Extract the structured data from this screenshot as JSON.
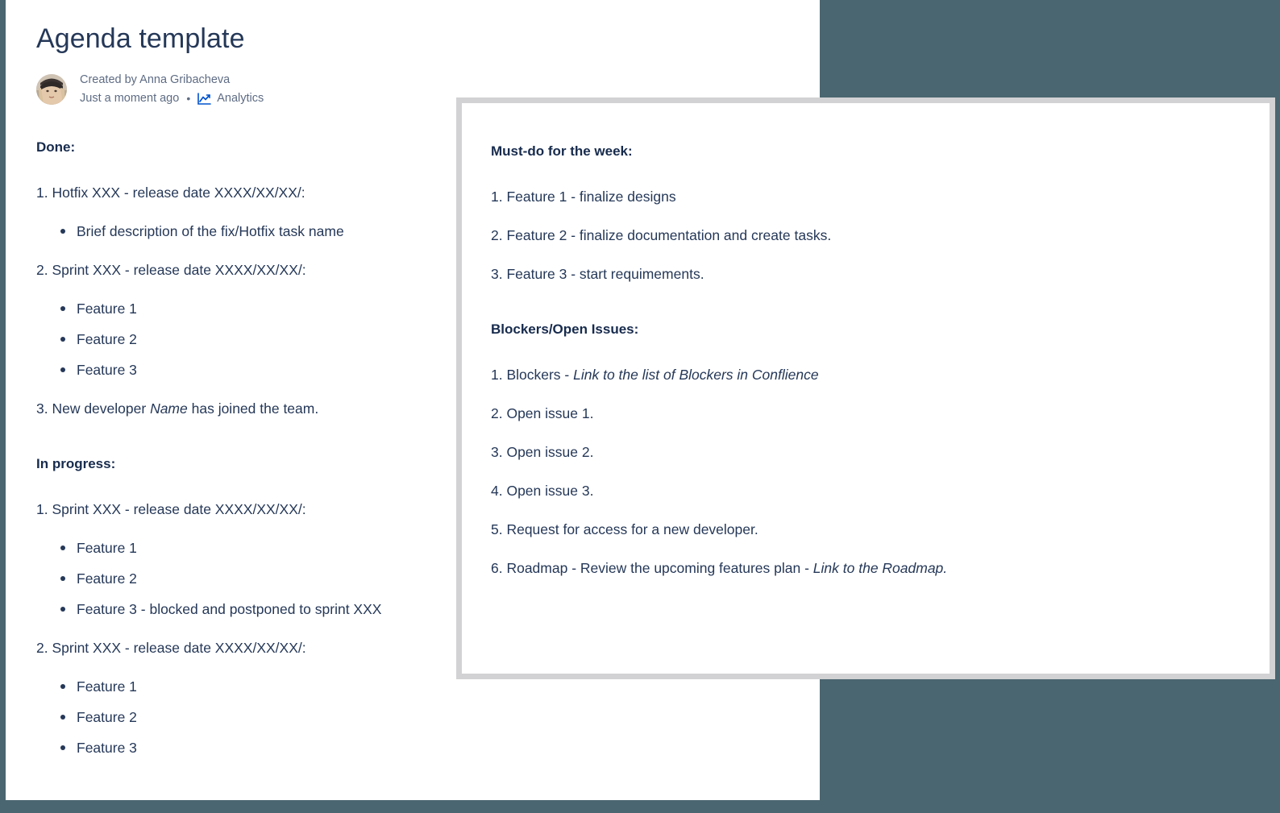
{
  "window": {
    "background_color": "#4a6670",
    "card_background": "#ffffff",
    "card_border_color": "#d2d2d4",
    "heading_color": "#172b4d",
    "body_text_color": "#253858",
    "meta_text_color": "#5e6c84",
    "accent_color": "#0052cc"
  },
  "page": {
    "title": "Agenda template",
    "byline": {
      "avatar_name": "avatar",
      "created_by": "Created by Anna Gribacheva",
      "timestamp": "Just a moment ago",
      "separator": "•",
      "analytics_icon": "analytics-chart-icon",
      "analytics_label": "Analytics"
    },
    "sections": [
      {
        "heading": "Done:",
        "blocks": [
          {
            "type": "para",
            "text": "1. Hotfix XXX - release date XXXX/XX/XX/:"
          },
          {
            "type": "list",
            "items": [
              "Brief description of the fix/Hotfix task name"
            ]
          },
          {
            "type": "para",
            "text": "2. Sprint XXX - release date XXXX/XX/XX/:"
          },
          {
            "type": "list",
            "items": [
              "Feature 1",
              "Feature 2",
              "Feature 3"
            ]
          },
          {
            "type": "para_italic",
            "prefix": "3. New developer ",
            "italic": "Name",
            "suffix": " has joined the team."
          }
        ]
      },
      {
        "heading": "In progress:",
        "blocks": [
          {
            "type": "para",
            "text": "1. Sprint XXX - release date XXXX/XX/XX/:"
          },
          {
            "type": "list",
            "items": [
              "Feature 1",
              "Feature 2",
              "Feature 3 - blocked and postponed to sprint XXX"
            ]
          },
          {
            "type": "para",
            "text": "2. Sprint XXX - release date XXXX/XX/XX/:"
          },
          {
            "type": "list",
            "items": [
              "Feature 1",
              "Feature 2",
              "Feature 3"
            ]
          }
        ]
      }
    ]
  },
  "overlay": {
    "sections": [
      {
        "heading": "Must-do for the week:",
        "items": [
          "1. Feature 1 - finalize designs",
          "2. Feature 2 - finalize documentation and create tasks.",
          "3. Feature 3 - start requimements."
        ]
      },
      {
        "heading": "Blockers/Open Issues:",
        "items_rich": [
          {
            "plain": "1. Blockers - ",
            "italic": "Link to the list of Blockers in Conflience",
            "tail": ""
          },
          {
            "plain": "2. Open issue 1.",
            "italic": "",
            "tail": ""
          },
          {
            "plain": "3. Open issue 2.",
            "italic": "",
            "tail": ""
          },
          {
            "plain": "4. Open issue 3.",
            "italic": "",
            "tail": ""
          },
          {
            "plain": "5. Request for access for a new developer.",
            "italic": "",
            "tail": ""
          },
          {
            "plain": "6. Roadmap - Review the upcoming features plan - ",
            "italic": "Link to the Roadmap.",
            "tail": ""
          }
        ]
      }
    ]
  }
}
